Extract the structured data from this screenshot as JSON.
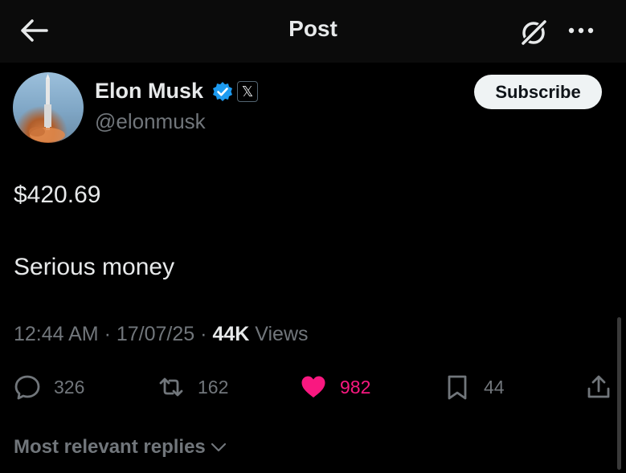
{
  "header": {
    "title": "Post",
    "back_icon": "arrow-left-icon",
    "grok_icon": "grok-icon",
    "more_icon": "more-horizontal-icon"
  },
  "author": {
    "name": "Elon Musk",
    "handle": "@elonmusk",
    "verified_badge_color": "#1d9bf0",
    "affiliate_badge": "𝕏",
    "subscribe_label": "Subscribe"
  },
  "post": {
    "lines": [
      "$420.69",
      "Serious money"
    ],
    "time": "12:44 AM",
    "date": "17/07/25",
    "views_count": "44K",
    "views_label": "Views"
  },
  "actions": {
    "replies": "326",
    "reposts": "162",
    "likes": "982",
    "bookmarks": "44",
    "like_color": "#f91880"
  },
  "replies_sort": {
    "label": "Most relevant replies"
  }
}
